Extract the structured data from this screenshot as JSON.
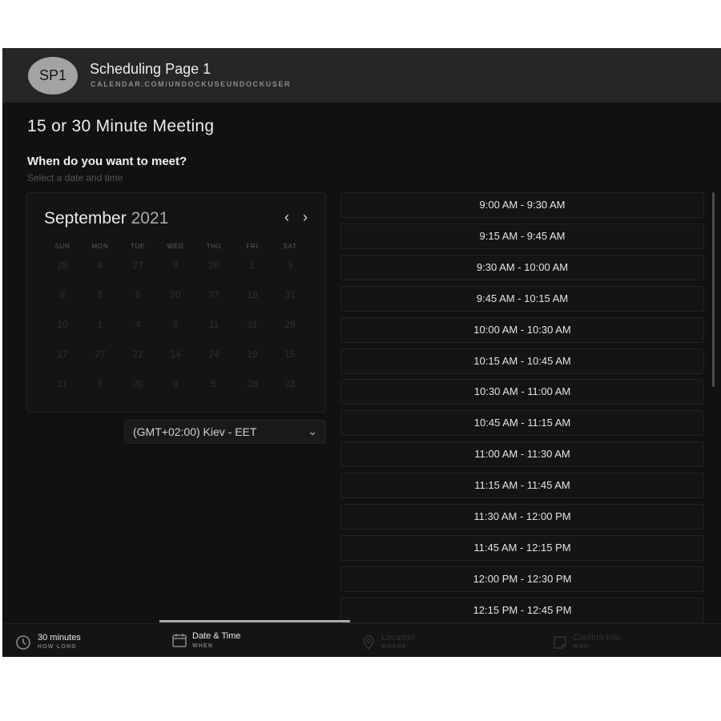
{
  "header": {
    "avatar_initials": "SP1",
    "title": "Scheduling Page 1",
    "url": "CALENDAR.COM/UNDOCKUSEUNDOCKUSER"
  },
  "meeting": {
    "title": "15 or 30 Minute Meeting",
    "question": "When do you want to meet?",
    "sub_question": "Select a date and time"
  },
  "calendar": {
    "month": "September",
    "year": "2021",
    "prev_icon": "chevron-left-icon",
    "next_icon": "chevron-right-icon",
    "prev_glyph": "‹",
    "next_glyph": "›",
    "weekdays": [
      "SUN",
      "MON",
      "TUE",
      "WED",
      "THU",
      "FRI",
      "SAT"
    ],
    "weeks": [
      [
        "28",
        "4",
        "27",
        "8",
        "26",
        "1",
        "3"
      ],
      [
        "8",
        "5",
        "6",
        "20",
        "27",
        "18",
        "31"
      ],
      [
        "10",
        "1",
        "4",
        "5",
        "11",
        "31",
        "28"
      ],
      [
        "17",
        "27",
        "21",
        "14",
        "24",
        "19",
        "15"
      ],
      [
        "11",
        "3",
        "20",
        "9",
        "5",
        "28",
        "28"
      ]
    ]
  },
  "timezone": {
    "label": "(GMT+02:00) Kiev - EET",
    "chevron": "⌄"
  },
  "slots": [
    "9:00 AM - 9:30 AM",
    "9:15 AM - 9:45 AM",
    "9:30 AM - 10:00 AM",
    "9:45 AM - 10:15 AM",
    "10:00 AM - 10:30 AM",
    "10:15 AM - 10:45 AM",
    "10:30 AM - 11:00 AM",
    "10:45 AM - 11:15 AM",
    "11:00 AM - 11:30 AM",
    "11:15 AM - 11:45 AM",
    "11:30 AM - 12:00 PM",
    "11:45 AM - 12:15 PM",
    "12:00 PM - 12:30 PM",
    "12:15 PM - 12:45 PM"
  ],
  "tabs": [
    {
      "label": "30 minutes",
      "sub": "HOW LONG",
      "icon": "clock-icon",
      "active": true
    },
    {
      "label": "Date & Time",
      "sub": "WHEN",
      "icon": "calendar-icon",
      "active": true
    },
    {
      "label": "Location",
      "sub": "WHERE",
      "icon": "location-pin-icon",
      "active": false
    },
    {
      "label": "Confirm Info",
      "sub": "WHO",
      "icon": "note-icon",
      "active": false
    }
  ],
  "colors": {
    "background": "#111111",
    "header": "#262626",
    "avatar": "#a3a3a3",
    "active_tab_indicator": "#a9a9a9"
  }
}
